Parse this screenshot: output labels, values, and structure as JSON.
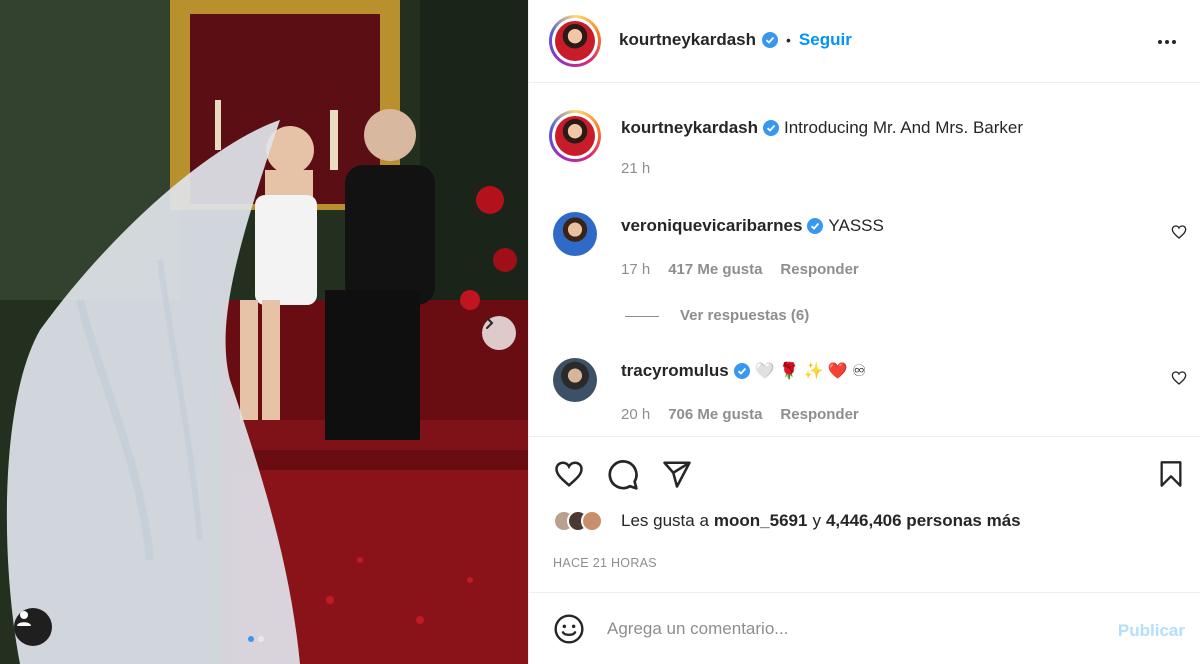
{
  "post": {
    "author": "kourtneykardash",
    "follow_label": "Seguir",
    "caption": "Introducing Mr. And Mrs. Barker",
    "caption_age": "21 h"
  },
  "comments": [
    {
      "user": "veroniquevicaribarnes",
      "text": "YASSS",
      "age": "17 h",
      "likes": "417 Me gusta",
      "reply_label": "Responder"
    },
    {
      "user": "tracyromulus",
      "text": "🤍 🌹 ✨ ❤️ ♾",
      "age": "20 h",
      "likes": "706 Me gusta",
      "reply_label": "Responder"
    }
  ],
  "view_replies": "Ver respuestas (6)",
  "likes_summary": {
    "prefix": "Les gusta a",
    "user": "moon_5691",
    "connector": "y",
    "count_text": "4,446,406 personas más"
  },
  "posted_time": "HACE 21 HORAS",
  "composer": {
    "placeholder": "Agrega un comentario...",
    "publish_label": "Publicar"
  },
  "colors": {
    "accent": "#0095f6",
    "verified": "#3897f0",
    "muted": "#8e8e8e",
    "publish_disabled": "#b2dffc"
  },
  "icons": [
    "more-options-icon",
    "heart-icon",
    "comment-icon",
    "share-icon",
    "bookmark-icon",
    "emoji-icon",
    "verified-icon",
    "chevron-right-icon",
    "user-tag-icon"
  ]
}
